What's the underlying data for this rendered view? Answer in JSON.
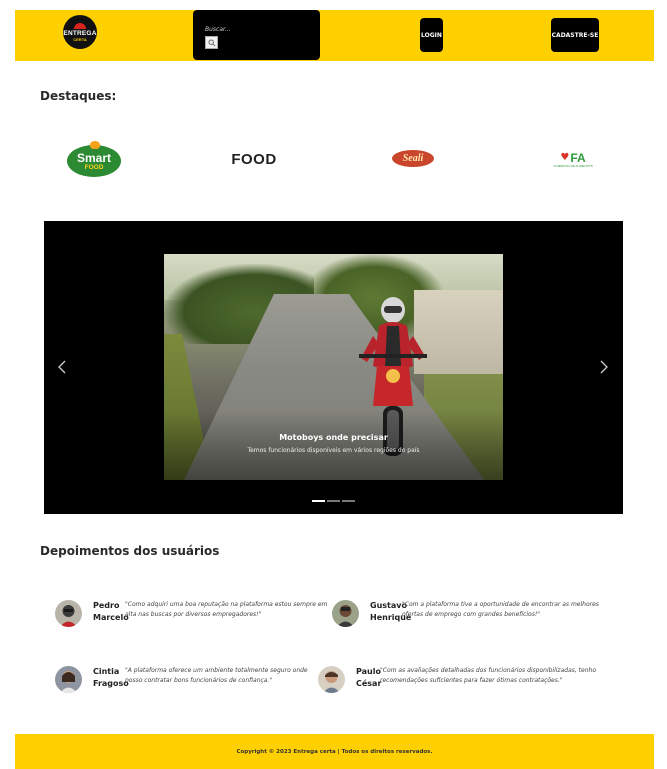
{
  "header": {
    "logo": {
      "line1": "ENTREGA",
      "line2": "CERTA"
    },
    "search": {
      "placeholder": "Buscar...",
      "button_icon": "search-icon"
    },
    "login_label": "LOGIN",
    "signup_label": "CADASTRE-SE",
    "colors": {
      "bar": "#ffd000",
      "buttons": "#000000"
    }
  },
  "highlights": {
    "title": "Destaques:",
    "brands": [
      {
        "line1": "Smart",
        "line2": "FOOD"
      },
      {
        "name": "FOOD"
      },
      {
        "name": "Seali"
      },
      {
        "name": "FA",
        "sub": "COMÉRCIO DE ALIMENTOS"
      }
    ]
  },
  "carousel": {
    "slide_title": "Motoboys onde precisar",
    "slide_subtitle": "Temos funcionários disponíveis em vários regiões do país",
    "prev_icon": "chevron-left-icon",
    "next_icon": "chevron-right-icon",
    "indicator_count": 3,
    "active_indicator": 1
  },
  "testimonials": {
    "title": "Depoimentos dos usuários",
    "items": [
      {
        "name": "Pedro Marcelo",
        "quote": "\"Como adquiri uma boa reputação na plataforma estou sempre em alta nas buscas por diversos empregadores!\""
      },
      {
        "name": "Gustavo Henrique",
        "quote": "\"Com a plataforma tive a oportunidade de encontrar as melhores ofertas de emprego com grandes benefícios!\""
      },
      {
        "name": "Cintia Fragoso",
        "quote": "\"A plataforma oferece um ambiente totalmente seguro onde posso contratar bons funcionários de confiança.\""
      },
      {
        "name": "Paulo César",
        "quote": "\"Com as avaliações detalhadas dos funcionários disponibilizadas, tenho recomendações suficientes para fazer ótimas contratações.\""
      }
    ]
  },
  "footer": {
    "copyright": "Copyright © 2023 Entrega certa | Todos os direitos reservados."
  }
}
